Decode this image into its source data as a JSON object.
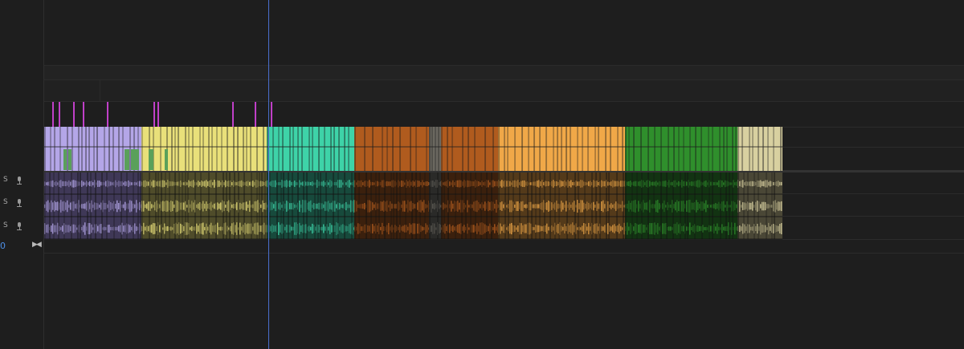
{
  "audio_tracks": [
    {
      "solo_label": "S",
      "mic_icon": "microphone-icon"
    },
    {
      "solo_label": "S",
      "mic_icon": "microphone-icon"
    },
    {
      "solo_label": "S",
      "mic_icon": "microphone-icon"
    }
  ],
  "timecode_display": "0",
  "snap_icon": "snap-icon",
  "clip_segments": [
    {
      "name": "segment-1",
      "color": "#b4a6e8",
      "dark": "#3f3857"
    },
    {
      "name": "segment-2",
      "color": "#e9e07a",
      "dark": "#4f4c2a"
    },
    {
      "name": "segment-3",
      "color": "#3ed3a8",
      "dark": "#174a3c"
    },
    {
      "name": "segment-4",
      "color": "#b05b1e",
      "dark": "#3b200d"
    },
    {
      "name": "segment-5",
      "color": "#6b6860",
      "dark": "#2a2a28"
    },
    {
      "name": "segment-6",
      "color": "#b05b1e",
      "dark": "#3b200d"
    },
    {
      "name": "segment-7",
      "color": "#f0a848",
      "dark": "#543a1a"
    },
    {
      "name": "segment-8",
      "color": "#2f8f2c",
      "dark": "#123312"
    },
    {
      "name": "segment-9",
      "color": "#d8d0a0",
      "dark": "#4a4736"
    }
  ],
  "marker_color": "#c040c8",
  "playhead_color": "#4a6fcf"
}
